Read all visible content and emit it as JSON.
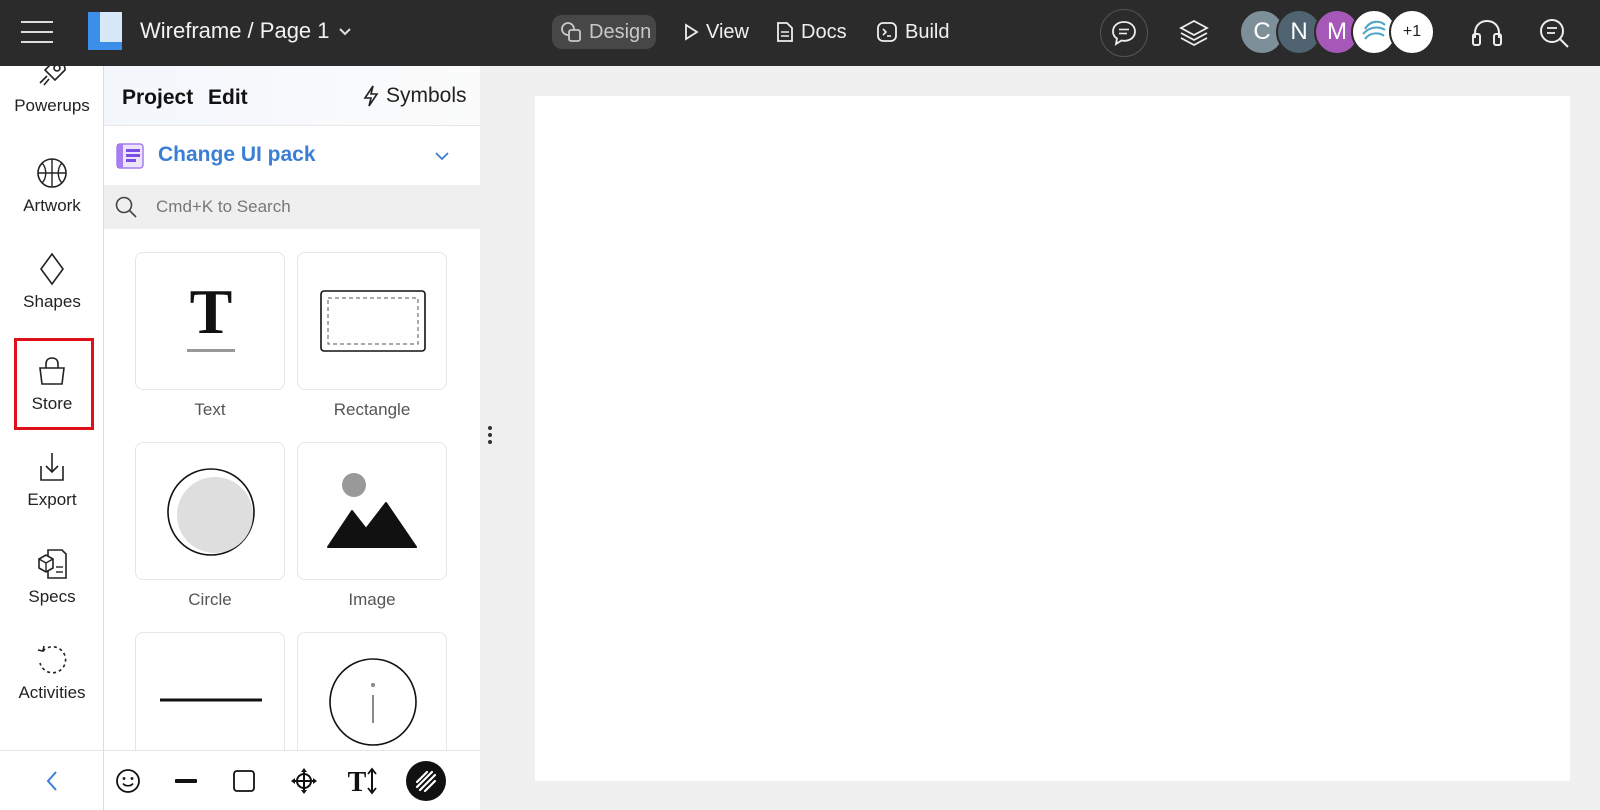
{
  "topbar": {
    "title": "Wireframe / Page 1",
    "nav": [
      {
        "label": "Design",
        "icon": "design-icon"
      },
      {
        "label": "View",
        "icon": "play-icon"
      },
      {
        "label": "Docs",
        "icon": "document-icon"
      },
      {
        "label": "Build",
        "icon": "terminal-icon"
      }
    ],
    "avatars": [
      {
        "initial": "C",
        "color": "#7d8f99"
      },
      {
        "initial": "N",
        "color": "#4f6470"
      },
      {
        "initial": "M",
        "color": "#a558b8"
      },
      {
        "initial": "",
        "color": "#ffffff"
      }
    ],
    "more_count": "+1"
  },
  "rail": {
    "items": [
      {
        "label": "Powerups",
        "icon": "rocket-icon"
      },
      {
        "label": "Artwork",
        "icon": "basketball-icon"
      },
      {
        "label": "Shapes",
        "icon": "diamond-icon"
      },
      {
        "label": "Store",
        "icon": "bag-icon"
      },
      {
        "label": "Export",
        "icon": "download-icon"
      },
      {
        "label": "Specs",
        "icon": "cube-doc-icon"
      },
      {
        "label": "Activities",
        "icon": "history-icon"
      }
    ]
  },
  "panel": {
    "tabs": [
      "Project",
      "Edit"
    ],
    "symbols_label": "Symbols",
    "ui_pack_label": "Change UI pack",
    "search_placeholder": "Cmd+K to Search",
    "tiles": [
      {
        "label": "Text",
        "icon": "text-icon"
      },
      {
        "label": "Rectangle",
        "icon": "rectangle-icon"
      },
      {
        "label": "Circle",
        "icon": "circle-icon"
      },
      {
        "label": "Image",
        "icon": "image-icon"
      },
      {
        "label": "",
        "icon": "line-icon"
      },
      {
        "label": "",
        "icon": "info-icon"
      }
    ]
  },
  "bottom_tools": [
    "emoji-icon",
    "line-tool-icon",
    "square-icon",
    "move-icon",
    "text-size-icon",
    "pen-icon"
  ],
  "colors": {
    "topbar_bg": "#2b2b2b",
    "accent_blue": "#3a7fd5",
    "highlight_red": "#e0101a"
  }
}
